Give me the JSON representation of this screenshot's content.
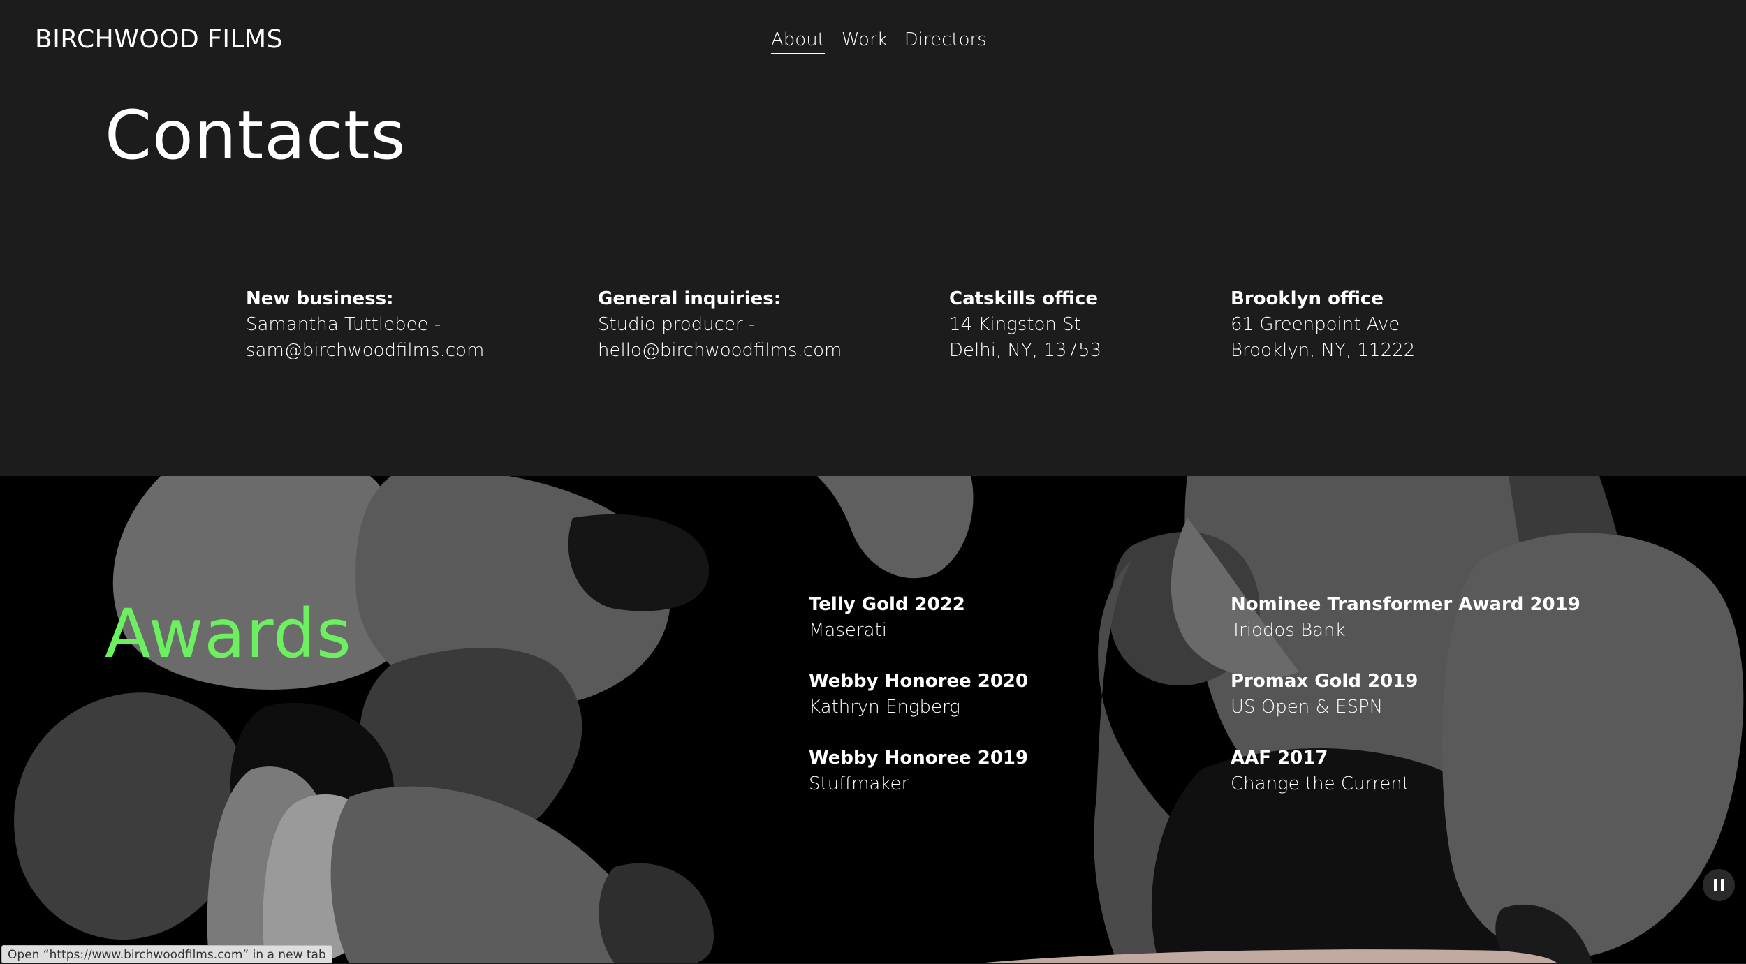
{
  "header": {
    "logo": "BIRCHWOOD FILMS",
    "nav": [
      {
        "label": "About",
        "active": true
      },
      {
        "label": "Work",
        "active": false
      },
      {
        "label": "Directors",
        "active": false
      }
    ]
  },
  "contacts": {
    "title": "Contacts",
    "columns": [
      {
        "heading": "New business:",
        "lines": [
          "Samantha Tuttlebee -",
          "sam@birchwoodfilms.com"
        ]
      },
      {
        "heading": "General inquiries:",
        "lines": [
          "Studio producer -",
          "hello@birchwoodfilms.com"
        ]
      },
      {
        "heading": "Catskills office",
        "lines": [
          "14 Kingston St",
          "Delhi, NY, 13753"
        ]
      },
      {
        "heading": "Brooklyn office",
        "lines": [
          "61 Greenpoint Ave",
          "Brooklyn, NY, 11222"
        ]
      }
    ]
  },
  "awards": {
    "title": "Awards",
    "title_color": "#6cf060",
    "items": [
      {
        "title": "Telly Gold 2022",
        "subtitle": "Maserati"
      },
      {
        "title": "Webby Honoree 2020",
        "subtitle": "Kathryn Engberg"
      },
      {
        "title": "Webby Honoree 2019",
        "subtitle": "Stuffmaker"
      },
      {
        "title": "Nominee Transformer Award 2019",
        "subtitle": "Triodos Bank"
      },
      {
        "title": "Promax Gold 2019",
        "subtitle": "US Open & ESPN"
      },
      {
        "title": "AAF 2017",
        "subtitle": "Change the Current"
      }
    ]
  },
  "controls": {
    "pause_icon": "pause-icon"
  },
  "status_bar": {
    "text": "Open “https://www.birchwoodfilms.com” in a new tab"
  },
  "colors": {
    "background": "#1c1c1c",
    "awards_background": "#000000",
    "accent_green": "#6cf060"
  }
}
